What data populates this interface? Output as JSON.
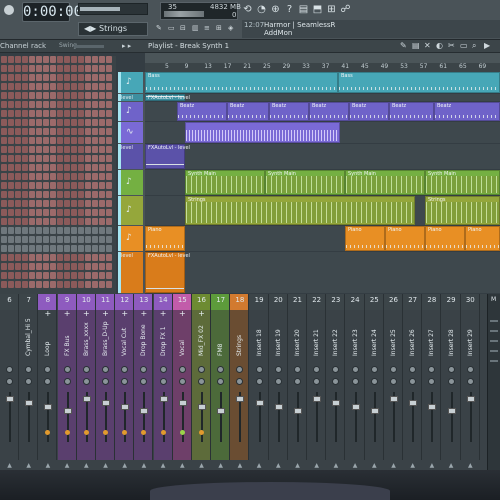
{
  "toolbar": {
    "time": "0:00:00",
    "cpu": "35",
    "memory": "4832 MB",
    "voices": "0",
    "pattern_selector": "Strings",
    "hint_time": "12:07",
    "hint_title": "Harmor | SeamlessR",
    "hint_user": "AddMon"
  },
  "channel_rack": {
    "title": "Channel rack",
    "swing_label": "Swing"
  },
  "playlist": {
    "snap_label": "▸ ▸",
    "title": "Playlist - Break Synth 1",
    "ruler": [
      "5",
      "9",
      "13",
      "17",
      "21",
      "25",
      "29",
      "33",
      "37",
      "41",
      "45",
      "49",
      "53",
      "57",
      "61",
      "65",
      "69"
    ]
  },
  "tracks": [
    {
      "id": "bass",
      "color": "#47a7b7",
      "clips": [
        {
          "name": "Bass"
        },
        {
          "name": "Bass"
        }
      ]
    },
    {
      "id": "bass-level",
      "color": "#3e8fa0",
      "label": "level",
      "clips": [
        {
          "name": "FXAutoLvl - level"
        }
      ]
    },
    {
      "id": "beatz",
      "color": "#6f63c9",
      "clips": [
        {
          "name": "Beatz"
        },
        {
          "name": "Beatz"
        },
        {
          "name": "Beatz"
        },
        {
          "name": "Beatz"
        },
        {
          "name": "Beatz"
        },
        {
          "name": "Beatz"
        },
        {
          "name": "Beatz"
        }
      ]
    },
    {
      "id": "beatz-wave",
      "color": "#7a6ad6",
      "clips": [
        {
          "name": ""
        }
      ]
    },
    {
      "id": "beatz-level",
      "color": "#5b52a9",
      "label": "level",
      "clips": [
        {
          "name": "FXAutoLvl - level"
        }
      ]
    },
    {
      "id": "synth",
      "color": "#74b042",
      "clips": [
        {
          "name": "Synth Main"
        },
        {
          "name": "Synth Main"
        },
        {
          "name": "Synth Main"
        },
        {
          "name": "Synth Main"
        }
      ]
    },
    {
      "id": "strings",
      "color": "#95a73b",
      "clips": [
        {
          "name": "Strings"
        },
        {
          "name": "Strings"
        }
      ]
    },
    {
      "id": "piano",
      "color": "#e88f24",
      "clips": [
        {
          "name": "Piano"
        },
        {
          "name": "Piano"
        },
        {
          "name": "Piano"
        },
        {
          "name": "Piano"
        },
        {
          "name": "Piano"
        },
        {
          "name": "Piano"
        }
      ]
    },
    {
      "id": "piano-level",
      "color": "#d97c1b",
      "label": "level",
      "clips": [
        {
          "name": "FXAutoLvl - level"
        }
      ]
    }
  ],
  "mixer": {
    "numbers": [
      "6",
      "7",
      "8",
      "9",
      "10",
      "11",
      "12",
      "13",
      "14",
      "15",
      "16",
      "17",
      "18",
      "19",
      "20",
      "21",
      "22",
      "23",
      "24",
      "25",
      "26",
      "27",
      "28",
      "29",
      "30"
    ],
    "strips": [
      "",
      "Cymbal_Hi 5",
      "Loop",
      "FX Bus",
      "Brass_xxxx",
      "Brass_D-Up",
      "Vocal Cut",
      "Drop Bone",
      "Drop FX 1",
      "Vocal",
      "Mid_FX 02",
      "FM8",
      "Strings",
      "Insert 18",
      "Insert 19",
      "Insert 20",
      "Insert 21",
      "Insert 22",
      "Insert 23",
      "Insert 24",
      "Insert 25",
      "Insert 26",
      "Insert 27",
      "Insert 28",
      "Insert 29"
    ]
  },
  "colors": {
    "accent_purple": "#8e5bbf",
    "accent_orange": "#e88f24",
    "accent_green": "#74b042",
    "accent_teal": "#47a7b7"
  }
}
